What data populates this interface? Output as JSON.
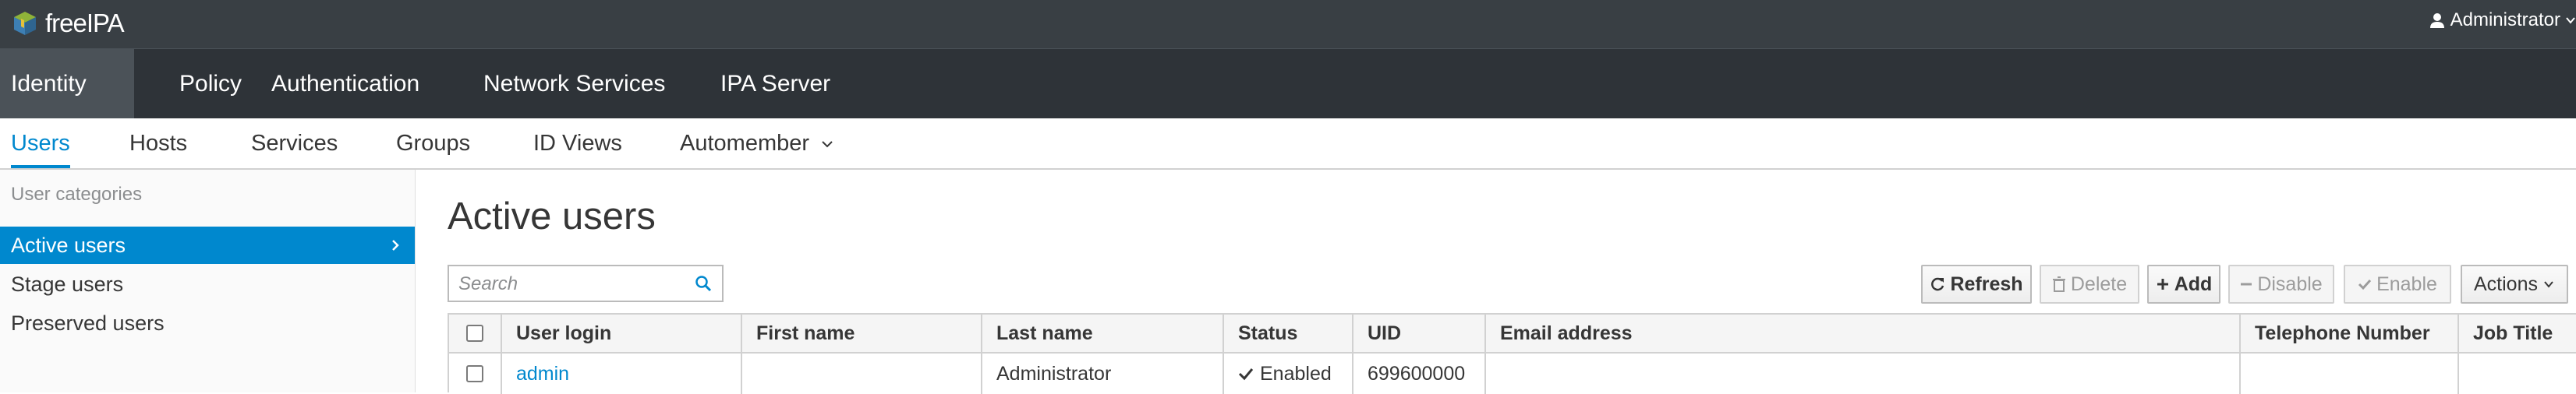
{
  "brand": {
    "name": "freeIPA"
  },
  "user_menu": {
    "label": "Administrator"
  },
  "primary_nav": [
    "Identity",
    "Policy",
    "Authentication",
    "Network Services",
    "IPA Server"
  ],
  "secondary_nav": [
    "Users",
    "Hosts",
    "Services",
    "Groups",
    "ID Views",
    "Automember"
  ],
  "sidebar": {
    "heading": "User categories",
    "items": [
      "Active users",
      "Stage users",
      "Preserved users"
    ]
  },
  "main": {
    "title": "Active users",
    "search_placeholder": "Search",
    "buttons": {
      "refresh": "Refresh",
      "delete": "Delete",
      "add": "Add",
      "disable": "Disable",
      "enable": "Enable",
      "actions": "Actions"
    },
    "table": {
      "columns": [
        "User login",
        "First name",
        "Last name",
        "Status",
        "UID",
        "Email address",
        "Telephone Number",
        "Job Title"
      ],
      "rows": [
        {
          "login": "admin",
          "first": "",
          "last": "Administrator",
          "status": "Enabled",
          "uid": "699600000",
          "email": "",
          "phone": "",
          "job": ""
        }
      ]
    }
  },
  "colors": {
    "topbar": "#393f44",
    "primary_nav": "#2e3338",
    "accent": "#0088ce"
  },
  "icons": [
    "ipa-logo-icon",
    "user-icon",
    "caret-down-icon",
    "chevron-down-icon",
    "chevron-right-icon",
    "search-icon",
    "refresh-icon",
    "trash-icon",
    "plus-icon",
    "minus-icon",
    "check-icon"
  ]
}
